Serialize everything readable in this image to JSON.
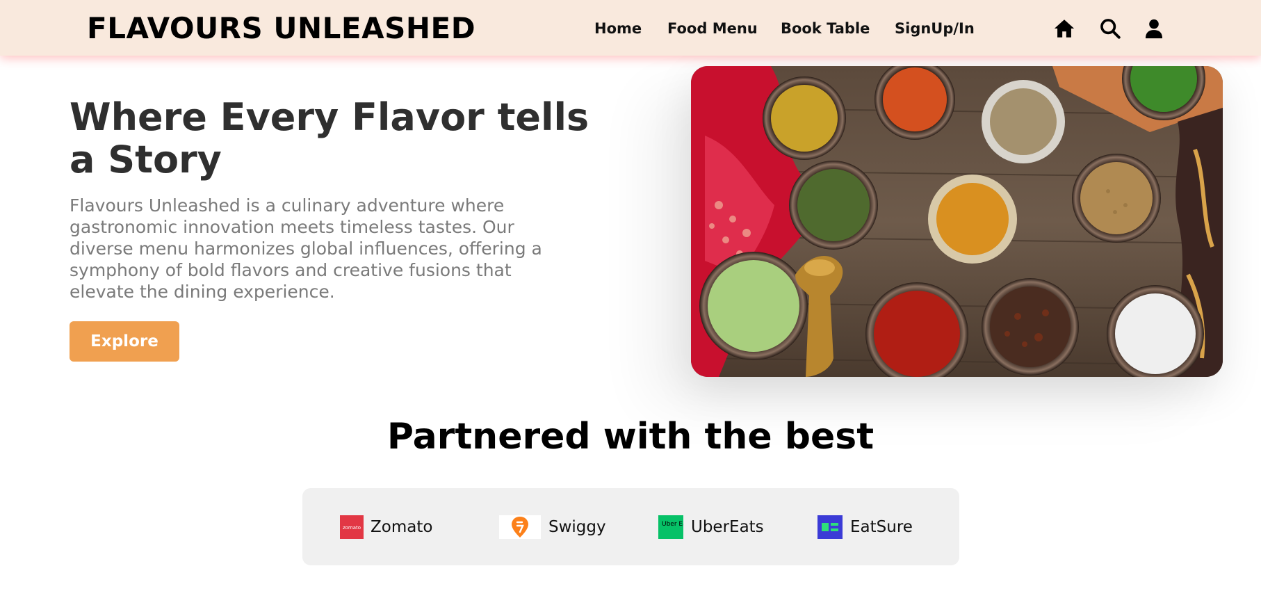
{
  "navbar": {
    "brand": "FLAVOURS UNLEASHED",
    "links": [
      {
        "label": "Home"
      },
      {
        "label": "Food Menu"
      },
      {
        "label": "Book Table"
      },
      {
        "label": "SignUp/In"
      }
    ],
    "icons": [
      "home-icon",
      "search-icon",
      "user-icon"
    ]
  },
  "hero": {
    "title": "Where Every Flavor tells a Story",
    "description": "Flavours Unleashed is a culinary adventure where gastronomic innovation meets timeless tastes. Our diverse menu harmonizes global influences, offering a symphony of bold flavors and creative fusions that elevate the dining experience.",
    "button_label": "Explore",
    "image_subject": "bowls of assorted spices on a wooden table"
  },
  "partners": {
    "title": "Partnered with the best",
    "items": [
      {
        "name": "Zomato",
        "logo_text": "zomato",
        "logo_color": "#e23744"
      },
      {
        "name": "Swiggy",
        "logo_color": "#fc8019"
      },
      {
        "name": "UberEats",
        "logo_text": "Uber Eats",
        "logo_color": "#06c167"
      },
      {
        "name": "EatSure",
        "logo_color": "#3b3bd6"
      }
    ]
  },
  "colors": {
    "navbar_bg": "#f9e9dd",
    "accent": "#f0a050",
    "title_text": "#2f2f2f",
    "body_text": "#7a7a7a",
    "partners_bg": "#f0f0f0"
  }
}
